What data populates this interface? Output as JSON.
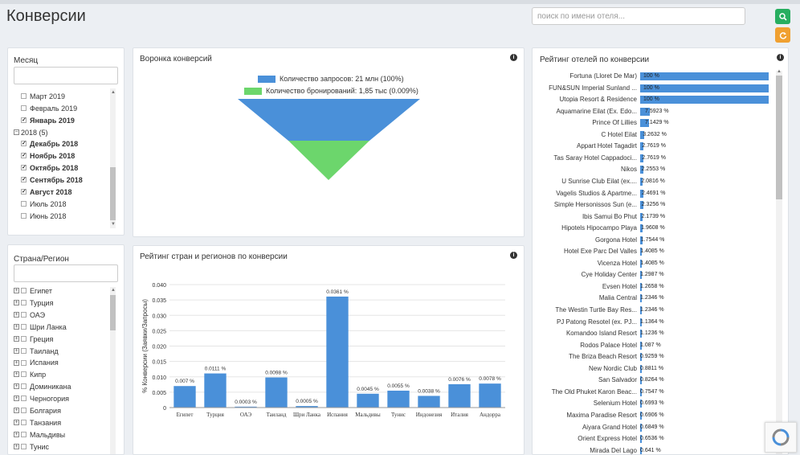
{
  "header": {
    "title": "Конверсии",
    "search_placeholder": "поиск по имени отеля..."
  },
  "month_filter": {
    "title": "Месяц",
    "items": [
      {
        "label": "Март 2019",
        "checked": false,
        "bold": false
      },
      {
        "label": "Февраль 2019",
        "checked": false,
        "bold": false
      },
      {
        "label": "Январь 2019",
        "checked": true,
        "bold": true
      }
    ],
    "group_2018": {
      "label": "2018 (5)"
    },
    "items_2018": [
      {
        "label": "Декабрь 2018",
        "checked": true,
        "bold": true
      },
      {
        "label": "Ноябрь 2018",
        "checked": true,
        "bold": true
      },
      {
        "label": "Октябрь 2018",
        "checked": true,
        "bold": true
      },
      {
        "label": "Сентябрь 2018",
        "checked": true,
        "bold": true
      },
      {
        "label": "Август 2018",
        "checked": true,
        "bold": true
      },
      {
        "label": "Июль 2018",
        "checked": false,
        "bold": false
      },
      {
        "label": "Июнь 2018",
        "checked": false,
        "bold": false
      }
    ]
  },
  "country_filter": {
    "title": "Страна/Регион",
    "items": [
      "Египет",
      "Турция",
      "ОАЭ",
      "Шри Ланка",
      "Греция",
      "Таиланд",
      "Испания",
      "Кипр",
      "Доминикана",
      "Черногория",
      "Болгария",
      "Танзания",
      "Мальдивы",
      "Тунис"
    ]
  },
  "funnel": {
    "title": "Воронка конверсий",
    "legend_requests": "Количество запросов: 21 млн (100%)",
    "legend_bookings": "Количество бронирований: 1,85 тыс (0.009%)",
    "color_requests": "#4a90d9",
    "color_bookings": "#6cd66c"
  },
  "country_chart_title": "Рейтинг стран и регионов по конверсии",
  "chart_data": {
    "type": "bar",
    "categories": [
      "Египет",
      "Турция",
      "ОАЭ",
      "Таиланд",
      "Шри Ланка",
      "Испания",
      "Мальдивы",
      "Тунис",
      "Индонезия",
      "Италия",
      "Андорра"
    ],
    "values": [
      0.007,
      0.0111,
      0.0003,
      0.0098,
      0.0005,
      0.0361,
      0.0045,
      0.0055,
      0.0038,
      0.0076,
      0.0078
    ],
    "labels": [
      "0.007 %",
      "0.0111 %",
      "0.0003 %",
      "0.0098 %",
      "0.0005 %",
      "0.0361 %",
      "0.0045 %",
      "0.0055 %",
      "0.0038 %",
      "0.0076 %",
      "0.0078 %"
    ],
    "ylabel": "% Конверсии (Заявки/Запросы)",
    "ylim": [
      0,
      0.04
    ],
    "yticks": [
      "0",
      "0.005",
      "0.010",
      "0.015",
      "0.020",
      "0.025",
      "0.030",
      "0.035",
      "0.040"
    ],
    "color": "#4a90d9",
    "grid": true
  },
  "hotels": {
    "title": "Рейтинг отелей по конверсии",
    "rows": [
      {
        "name": "Fortuna (Lloret De Mar)",
        "value": 100,
        "label": "100 %"
      },
      {
        "name": "FUN&SUN Imperial Sunland ...",
        "value": 100,
        "label": "100 %"
      },
      {
        "name": "Utopia Resort & Residence",
        "value": 100,
        "label": "100 %"
      },
      {
        "name": "Aquamarine Eilat (Ex. Edo...",
        "value": 7.5923,
        "label": "7.5923 %"
      },
      {
        "name": "Prince Of Lillies",
        "value": 7.1429,
        "label": "7.1429 %"
      },
      {
        "name": "C Hotel Eilat",
        "value": 3.2632,
        "label": "3.2632 %"
      },
      {
        "name": "Appart Hotel Tagadirt",
        "value": 2.7619,
        "label": "2.7619 %"
      },
      {
        "name": "Tas Saray Hotel Cappadoci...",
        "value": 2.7619,
        "label": "2.7619 %"
      },
      {
        "name": "Nikos",
        "value": 2.2553,
        "label": "2.2553 %"
      },
      {
        "name": "U Sunrise Club Eilat (ex....",
        "value": 2.0816,
        "label": "2.0816 %"
      },
      {
        "name": "Vagelis Studios & Apartme...",
        "value": 2.4691,
        "label": "2.4691 %"
      },
      {
        "name": "Simple Hersonissos Sun (e...",
        "value": 2.3256,
        "label": "2.3256 %"
      },
      {
        "name": "Ibis Samui Bo Phut",
        "value": 2.1739,
        "label": "2.1739 %"
      },
      {
        "name": "Hipotels Hipocampo Playa",
        "value": 1.9608,
        "label": "1.9608 %"
      },
      {
        "name": "Gorgona Hotel",
        "value": 1.7544,
        "label": "1.7544 %"
      },
      {
        "name": "Hotel Exe Parc Del Valles",
        "value": 1.4085,
        "label": "1.4085 %"
      },
      {
        "name": "Vicenza Hotel",
        "value": 1.4085,
        "label": "1.4085 %"
      },
      {
        "name": "Cye Holiday Center",
        "value": 1.2987,
        "label": "1.2987 %"
      },
      {
        "name": "Evsen Hotel",
        "value": 1.2658,
        "label": "1.2658 %"
      },
      {
        "name": "Malia Central",
        "value": 1.2346,
        "label": "1.2346 %"
      },
      {
        "name": "The Westin Turtle Bay Res...",
        "value": 1.2346,
        "label": "1.2346 %"
      },
      {
        "name": "PJ Patong Resotel (ex. PJ...",
        "value": 1.1364,
        "label": "1.1364 %"
      },
      {
        "name": "Komandoo Island Resort",
        "value": 1.1236,
        "label": "1.1236 %"
      },
      {
        "name": "Rodos Palace Hotel",
        "value": 1.087,
        "label": "1.087 %"
      },
      {
        "name": "The Briza Beach Resort",
        "value": 0.9259,
        "label": "0.9259 %"
      },
      {
        "name": "New Nordic Club",
        "value": 0.8811,
        "label": "0.8811 %"
      },
      {
        "name": "San Salvador",
        "value": 0.8264,
        "label": "0.8264 %"
      },
      {
        "name": "The Old Phuket Karon Beac...",
        "value": 0.7547,
        "label": "0.7547 %"
      },
      {
        "name": "Selenium Hotel",
        "value": 0.6993,
        "label": "0.6993 %"
      },
      {
        "name": "Maxima Paradise Resort",
        "value": 0.6906,
        "label": "0.6906 %"
      },
      {
        "name": "Aiyara Grand Hotel",
        "value": 0.6849,
        "label": "0.6849 %"
      },
      {
        "name": "Orient Express Hotel",
        "value": 0.6536,
        "label": "0.6536 %"
      },
      {
        "name": "Mirada Del Lago",
        "value": 0.641,
        "label": "0.641 %"
      }
    ],
    "bar_color": "#4a90d9"
  }
}
